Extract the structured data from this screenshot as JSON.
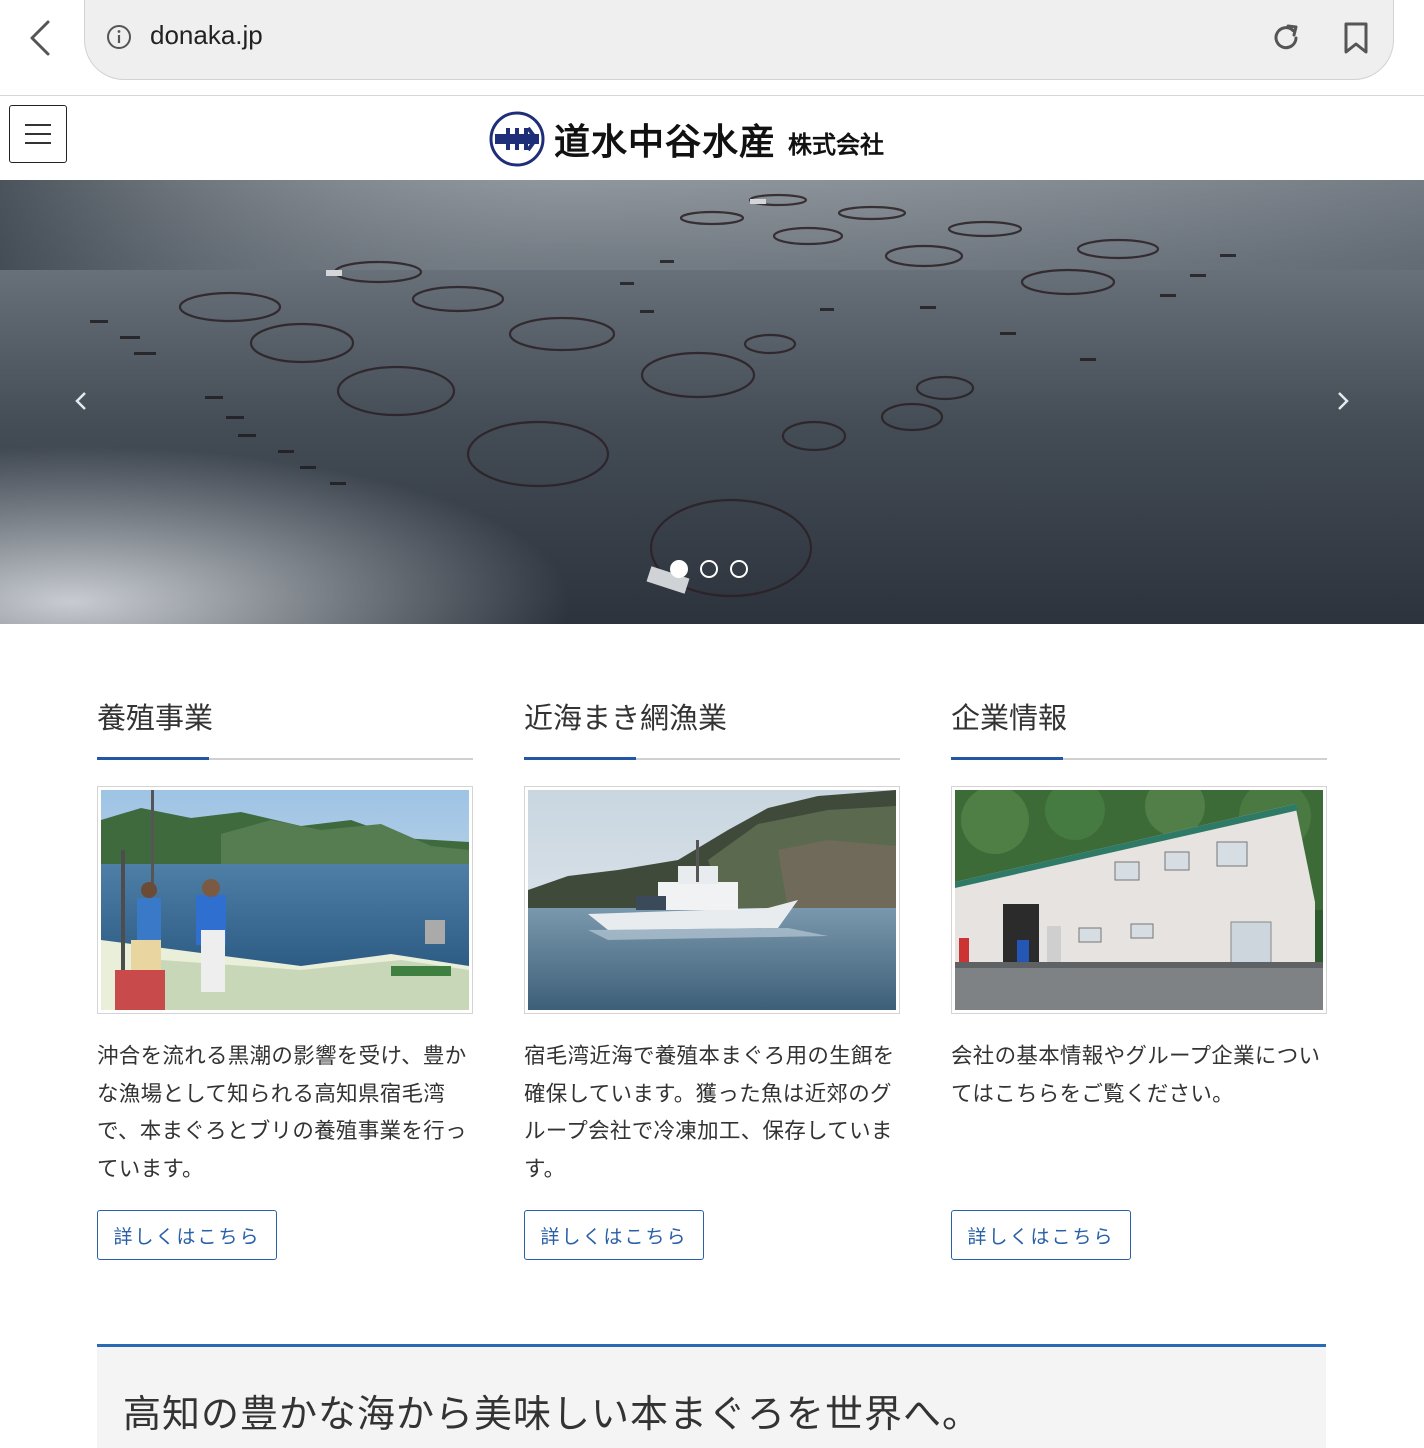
{
  "browser": {
    "url": "donaka.jp"
  },
  "header": {
    "logo_name": "道水中谷水産",
    "logo_suffix": "株式会社"
  },
  "hero": {
    "slide_count": 3,
    "active_slide": 1
  },
  "columns": [
    {
      "title": "養殖事業",
      "text": "沖合を流れる黒潮の影響を受け、豊かな漁場として知られる高知県宿毛湾で、本まぐろとブリの養殖事業を行っています。",
      "button": "詳しくはこちら"
    },
    {
      "title": "近海まき網漁業",
      "text": "宿毛湾近海で養殖本まぐろ用の生餌を確保しています。獲った魚は近郊のグループ会社で冷凍加工、保存しています。",
      "button": "詳しくはこちら"
    },
    {
      "title": "企業情報",
      "text": "会社の基本情報やグループ企業についてはこちらをご覧ください。",
      "button": "詳しくはこちら"
    }
  ],
  "tagline": "高知の豊かな海から美味しい本まぐろを世界へ。",
  "colors": {
    "accent_blue": "#2257a6",
    "button_blue": "#2960a8",
    "tagline_border": "#2a6ab5"
  }
}
